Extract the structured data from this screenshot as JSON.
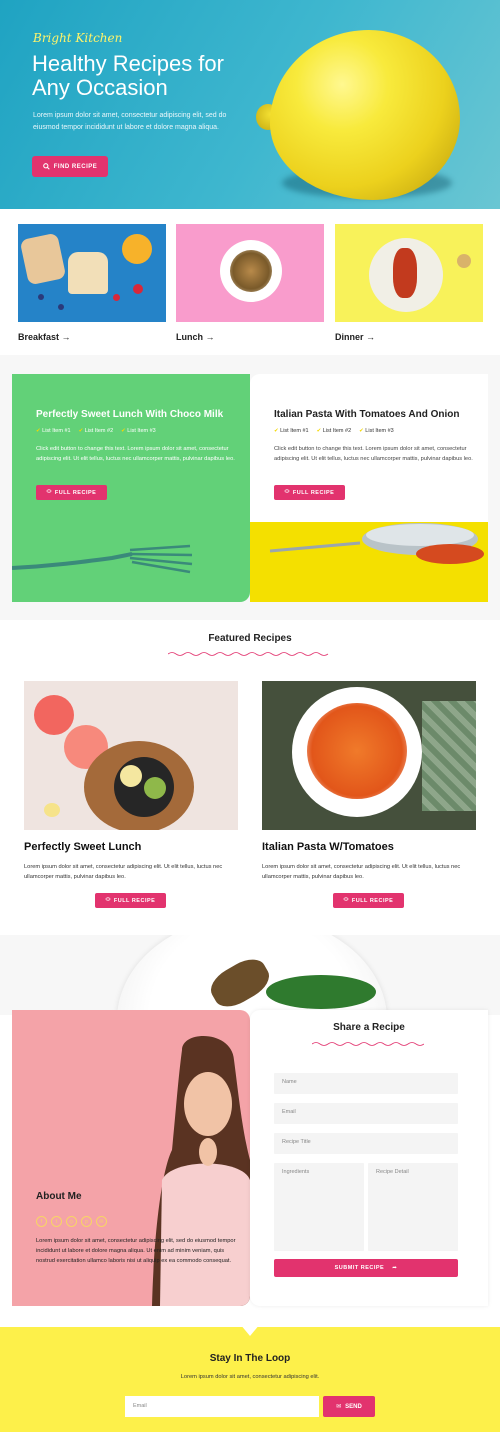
{
  "hero": {
    "brand": "Bright Kitchen",
    "title": "Healthy Recipes for Any Occasion",
    "description": "Lorem ipsum dolor sit amet, consectetur adipiscing elit, sed do eiusmod tempor incididunt ut labore et dolore magna aliqua.",
    "button_label": "FIND RECIPE",
    "button_icon": "search-icon",
    "accent_color": "#e2336e"
  },
  "categories": [
    {
      "label": "Breakfast →"
    },
    {
      "label": "Lunch →"
    },
    {
      "label": "Dinner →"
    }
  ],
  "split_recipes": [
    {
      "title": "Perfectly Sweet Lunch With Choco Milk",
      "list": [
        "List Item #1",
        "List Item #2",
        "List Item #3"
      ],
      "body": "Click edit button to change this text. Lorem ipsum dolor sit amet, consectetur adipiscing elit. Ut elit tellus, luctus nec ullamcorper mattis, pulvinar dapibus leo.",
      "button_label": "FULL RECIPE"
    },
    {
      "title": "Italian Pasta With Tomatoes And Onion",
      "list": [
        "List Item #1",
        "List Item #2",
        "List Item #3"
      ],
      "body": "Click edit button to change this text. Lorem ipsum dolor sit amet, consectetur adipiscing elit. Ut elit tellus, luctus nec ullamcorper mattis, pulvinar dapibus leo.",
      "button_label": "FULL RECIPE"
    }
  ],
  "featured": {
    "title": "Featured Recipes",
    "cards": [
      {
        "title": "Perfectly Sweet Lunch",
        "body": "Lorem ipsum dolor sit amet, consectetur adipiscing elit. Ut elit tellus, luctus nec ullamcorper mattis, pulvinar dapibus leo.",
        "button_label": "FULL RECIPE"
      },
      {
        "title": "Italian Pasta W/Tomatoes",
        "body": "Lorem ipsum dolor sit amet, consectetur adipiscing elit. Ut elit tellus, luctus nec ullamcorper mattis, pulvinar dapibus leo.",
        "button_label": "FULL RECIPE"
      }
    ]
  },
  "about": {
    "title": "About Me",
    "social_icons": [
      "facebook-icon",
      "twitter-icon",
      "instagram-icon",
      "pinterest-icon",
      "email-icon"
    ],
    "body": "Lorem ipsum dolor sit amet, consectetur adipiscing elit, sed do eiusmod tempor incididunt ut labore et dolore magna aliqua. Ut enim ad minim veniam, quis nostrud exercitation ullamco laboris nisi ut aliquip ex ea commodo consequat."
  },
  "share": {
    "title": "Share a Recipe",
    "name_placeholder": "Name",
    "email_placeholder": "Email",
    "recipe_title_placeholder": "Recipe Title",
    "ingredients_placeholder": "Ingredients",
    "detail_placeholder": "Recipe Detail",
    "submit_label": "SUBMIT RECIPE"
  },
  "newsletter": {
    "title": "Stay In The Loop",
    "subtitle": "Lorem ipsum dolor sit amet, consectetur adipiscing elit.",
    "email_placeholder": "Email",
    "send_label": "SEND",
    "background_color": "#fdf04a"
  }
}
